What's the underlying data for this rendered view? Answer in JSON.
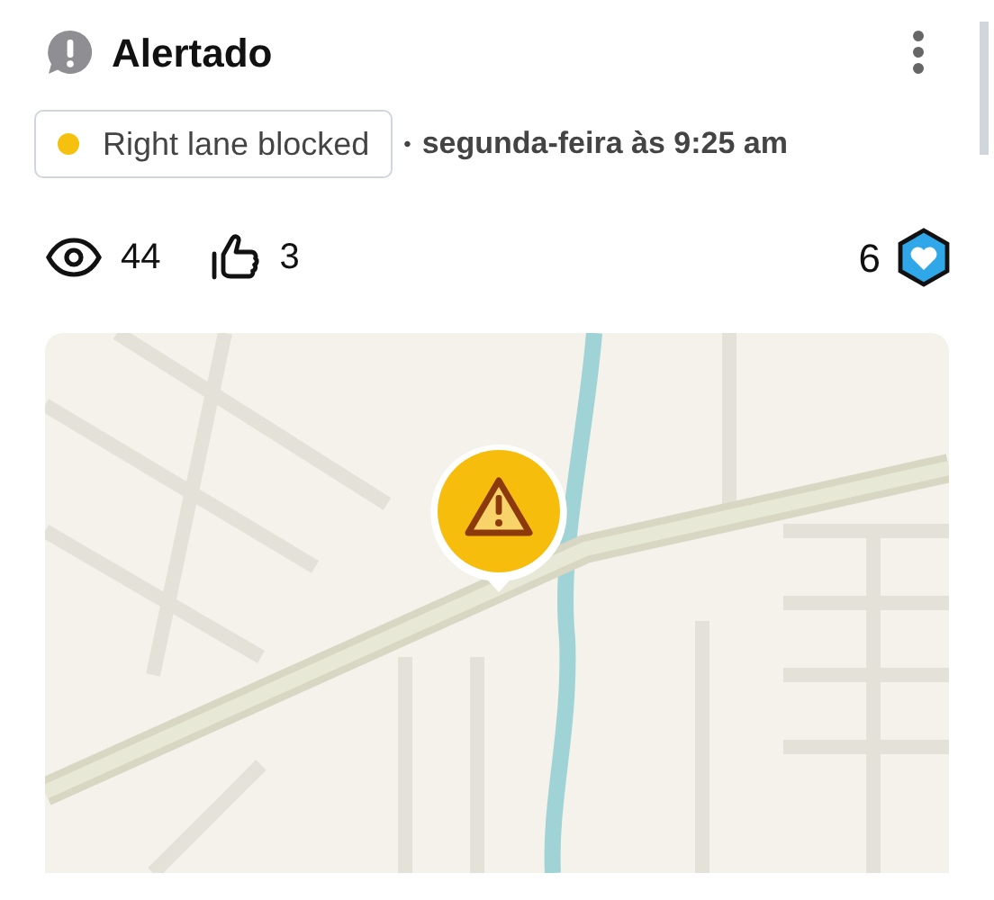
{
  "header": {
    "title": "Alertado"
  },
  "report": {
    "tag": {
      "label": "Right lane blocked",
      "color": "#f5c10e"
    },
    "separator": "•",
    "time": "segunda-feira às 9:25 am"
  },
  "stats": {
    "views": "44",
    "likes": "3",
    "points": "6"
  }
}
